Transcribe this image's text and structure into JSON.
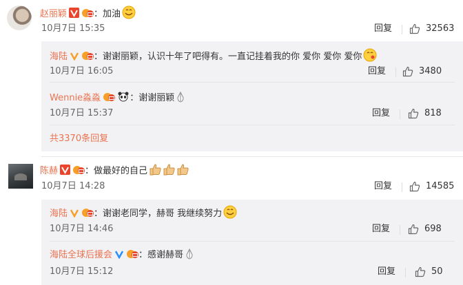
{
  "comments": [
    {
      "username": "赵丽颖",
      "text": "：加油",
      "time": "10月7日 15:35",
      "reply_label": "回复",
      "likes": "32563",
      "replies": [
        {
          "username": "海陆",
          "text": "：谢谢丽颖，认识十年了吧得有。一直记挂着我的你 爱你 爱你 爱你",
          "time": "10月7日 16:05",
          "reply_label": "回复",
          "likes": "3480"
        },
        {
          "username": "Wennie淼淼",
          "text": "：谢谢丽颖",
          "time": "10月7日 15:37",
          "reply_label": "回复",
          "likes": "818"
        }
      ],
      "more_replies": "共3370条回复"
    },
    {
      "username": "陈赫",
      "text": "：做最好的自己",
      "time": "10月7日 14:28",
      "reply_label": "回复",
      "likes": "14585",
      "replies": [
        {
          "username": "海陆",
          "text": "：谢谢老同学，赫哥 我继续努力",
          "time": "10月7日 14:46",
          "reply_label": "回复",
          "likes": "698"
        },
        {
          "username": "海陆全球后援会",
          "text": "：感谢赫哥",
          "time": "10月7日 15:12",
          "reply_label": "回复",
          "likes": "50"
        }
      ]
    }
  ],
  "colors": {
    "username": "#eb7350",
    "vip_red": "#e8452c",
    "verified_orange": "#f6a02a",
    "verified_blue": "#2a8ff7",
    "sub_bg": "#f2f2f5"
  }
}
